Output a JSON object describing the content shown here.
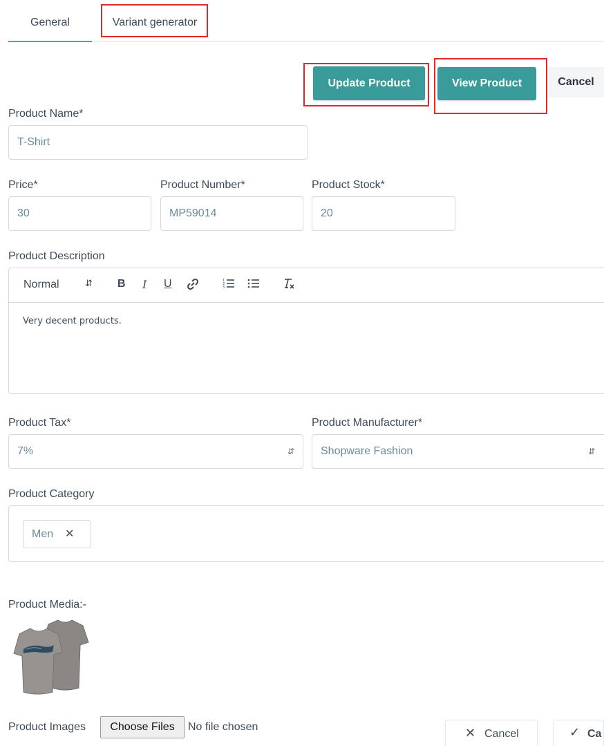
{
  "tabs": [
    {
      "label": "General",
      "active": true
    },
    {
      "label": "Variant generator",
      "active": false
    }
  ],
  "actions": {
    "update_label": "Update Product",
    "view_label": "View Product",
    "cancel_label": "Cancel"
  },
  "form": {
    "product_name": {
      "label": "Product Name*",
      "value": "T-Shirt"
    },
    "price": {
      "label": "Price*",
      "value": "30"
    },
    "product_number": {
      "label": "Product Number*",
      "value": "MP59014"
    },
    "product_stock": {
      "label": "Product Stock*",
      "value": "20"
    },
    "description": {
      "label": "Product Description",
      "format_select": "Normal",
      "content": "Very decent products."
    },
    "tax": {
      "label": "Product Tax*",
      "value": "7%"
    },
    "manufacturer": {
      "label": "Product Manufacturer*",
      "value": "Shopware Fashion"
    },
    "category": {
      "label": "Product Category",
      "chips": [
        "Men"
      ]
    },
    "media": {
      "label": "Product Media:-"
    },
    "images": {
      "label": "Product Images",
      "button": "Choose Files",
      "status": "No file chosen"
    }
  },
  "footer": {
    "cancel_label": "Cancel",
    "save_label": "Ca"
  },
  "colors": {
    "primary": "#3a9c9a",
    "highlight": "#e32626",
    "tab_active": "#3aa1d8"
  }
}
